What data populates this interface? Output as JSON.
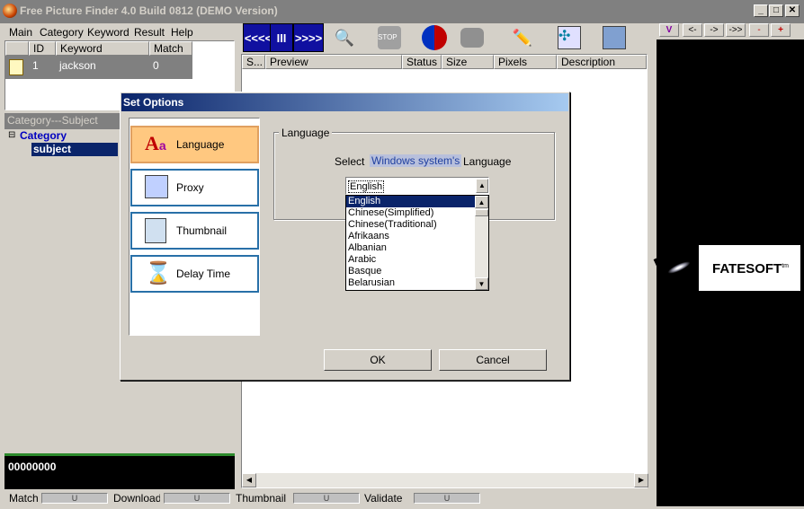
{
  "window": {
    "title": "Free Picture Finder 4.0 Build 0812  (DEMO Version)"
  },
  "menu": [
    "Main",
    "Category",
    "Keyword",
    "Result",
    "Help"
  ],
  "keyword_table": {
    "columns": [
      "ID",
      "Keyword",
      "Match"
    ],
    "rows": [
      {
        "id": "1",
        "keyword": "jackson",
        "match": "0"
      }
    ]
  },
  "category_panel": {
    "header": "Category---Subject",
    "root": "Category",
    "child": "subject"
  },
  "counter": "00000000",
  "toolbar": {
    "prev": "<<<<",
    "pause": "III",
    "next": ">>>>"
  },
  "results_columns": [
    "S...",
    "Preview",
    "Status",
    "Size",
    "Pixels",
    "Description"
  ],
  "right_toolbar": [
    "V",
    "<-",
    "->",
    "->>",
    "-",
    "+"
  ],
  "status_bar": [
    {
      "label": "Match",
      "gauge": "U"
    },
    {
      "label": "Download",
      "gauge": "U"
    },
    {
      "label": "Thumbnail",
      "gauge": "U"
    },
    {
      "label": "Validate",
      "gauge": "U"
    }
  ],
  "ad": {
    "brand": "FATESOFT",
    "tm": "tm"
  },
  "dialog": {
    "title": "Set Options",
    "options": [
      "Language",
      "Proxy",
      "Thumbnail",
      "Delay Time"
    ],
    "group_label": "Language",
    "select_prefix": "Select",
    "select_highlight": "Windows system's",
    "select_suffix": "Language",
    "combo_value": "English",
    "languages": [
      "English",
      "Chinese(Simplified)",
      "Chinese(Traditional)",
      "Afrikaans",
      "Albanian",
      "Arabic",
      "Basque",
      "Belarusian"
    ],
    "ok": "OK",
    "cancel": "Cancel"
  }
}
